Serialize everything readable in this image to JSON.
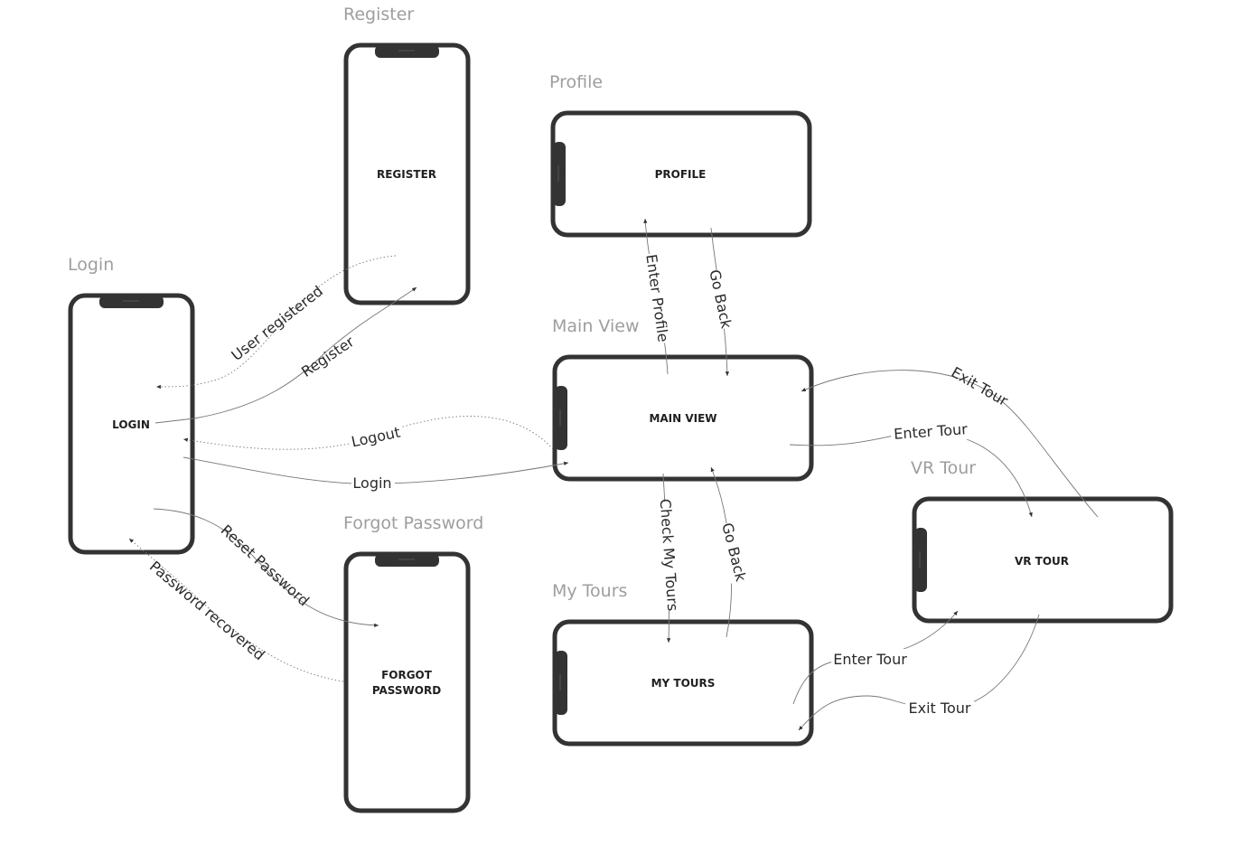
{
  "frames": [
    {
      "id": "login",
      "title": "Login",
      "label": [
        "LOGIN"
      ]
    },
    {
      "id": "register",
      "title": "Register",
      "label": [
        "REGISTER"
      ]
    },
    {
      "id": "forgot",
      "title": "Forgot Password",
      "label": [
        "FORGOT",
        "PASSWORD"
      ]
    },
    {
      "id": "profile",
      "title": "Profile",
      "label": [
        "PROFILE"
      ]
    },
    {
      "id": "main",
      "title": "Main View",
      "label": [
        "MAIN VIEW"
      ]
    },
    {
      "id": "mytours",
      "title": "My Tours",
      "label": [
        "MY TOURS"
      ]
    },
    {
      "id": "vrtour",
      "title": "VR Tour",
      "label": [
        "VR TOUR"
      ]
    }
  ],
  "edges": [
    {
      "from": "register",
      "to": "login",
      "label": "User registered",
      "style": "dotted"
    },
    {
      "from": "login",
      "to": "register",
      "label": "Register",
      "style": "solid"
    },
    {
      "from": "main",
      "to": "login",
      "label": "Logout",
      "style": "dotted"
    },
    {
      "from": "login",
      "to": "main",
      "label": "Login",
      "style": "solid"
    },
    {
      "from": "login",
      "to": "forgot",
      "label": "Reset Password",
      "style": "solid"
    },
    {
      "from": "forgot",
      "to": "login",
      "label": "Password recovered",
      "style": "dotted"
    },
    {
      "from": "main",
      "to": "profile",
      "label": "Enter Profile",
      "style": "solid"
    },
    {
      "from": "profile",
      "to": "main",
      "label": "Go Back",
      "style": "solid"
    },
    {
      "from": "main",
      "to": "mytours",
      "label": "Check My Tours",
      "style": "solid"
    },
    {
      "from": "mytours",
      "to": "main",
      "label": "Go Back",
      "style": "solid"
    },
    {
      "from": "main",
      "to": "vrtour",
      "label": "Enter Tour",
      "style": "solid"
    },
    {
      "from": "vrtour",
      "to": "main",
      "label": "Exit Tour",
      "style": "solid"
    },
    {
      "from": "mytours",
      "to": "vrtour",
      "label": "Enter Tour",
      "style": "solid"
    },
    {
      "from": "vrtour",
      "to": "mytours",
      "label": "Exit Tour",
      "style": "solid"
    }
  ]
}
